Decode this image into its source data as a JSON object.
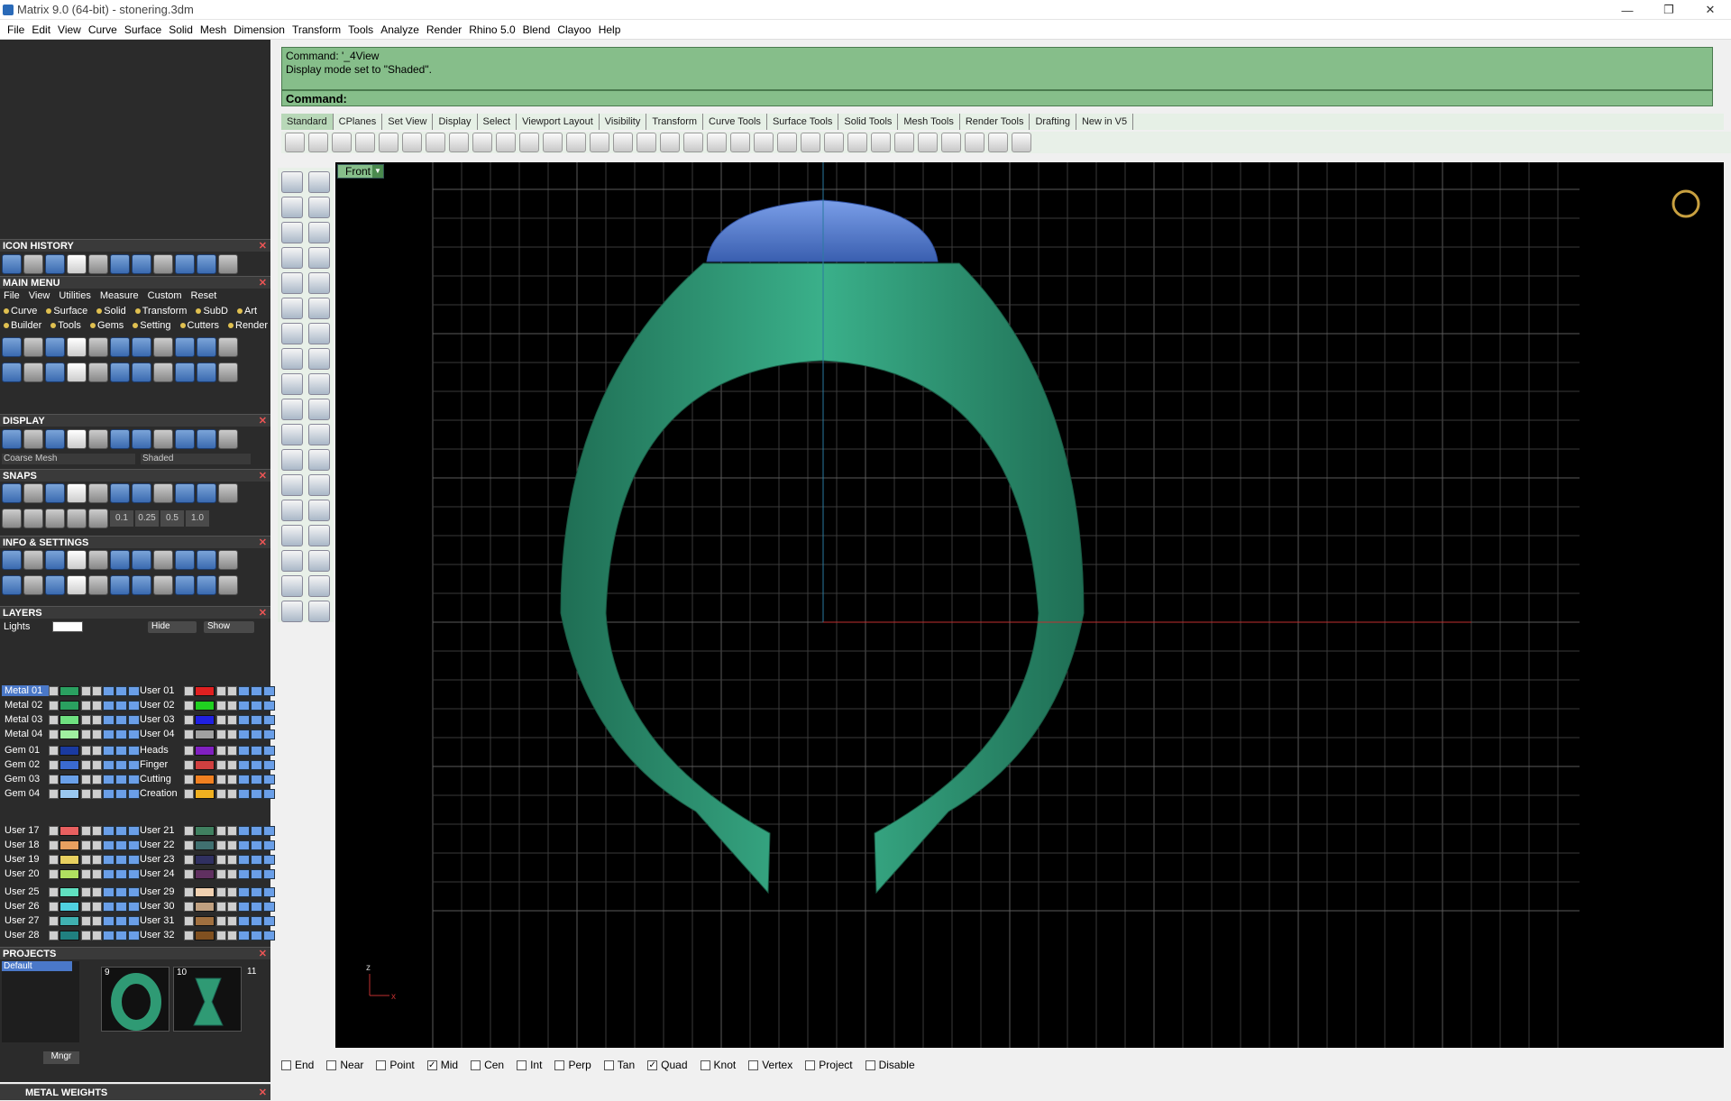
{
  "window": {
    "title": "Matrix 9.0 (64-bit) - stonering.3dm",
    "minimize": "—",
    "restore": "❐",
    "close": "✕"
  },
  "menu": [
    "File",
    "Edit",
    "View",
    "Curve",
    "Surface",
    "Solid",
    "Mesh",
    "Dimension",
    "Transform",
    "Tools",
    "Analyze",
    "Render",
    "Rhino 5.0",
    "Blend",
    "Clayoo",
    "Help"
  ],
  "command": {
    "history1": "Command: '_4View",
    "history2": "Display mode set to \"Shaded\".",
    "prompt": "Command:",
    "value": ""
  },
  "tabs": [
    "Standard",
    "CPlanes",
    "Set View",
    "Display",
    "Select",
    "Viewport Layout",
    "Visibility",
    "Transform",
    "Curve Tools",
    "Surface Tools",
    "Solid Tools",
    "Mesh Tools",
    "Render Tools",
    "Drafting",
    "New in V5"
  ],
  "viewport": {
    "name": "Front",
    "axis_z": "z",
    "axis_x": "x"
  },
  "panels": {
    "icon_history": "ICON HISTORY",
    "main_menu": "MAIN MENU",
    "main_menu_tabs": [
      "File",
      "View",
      "Utilities",
      "Measure",
      "Custom",
      "Reset"
    ],
    "main_menu_row1": [
      "Curve",
      "Surface",
      "Solid",
      "Transform",
      "SubD",
      "Art"
    ],
    "main_menu_row2": [
      "Builder",
      "Tools",
      "Gems",
      "Setting",
      "Cutters",
      "Render"
    ],
    "display": "DISPLAY",
    "display_mesh": "Coarse Mesh",
    "display_mode": "Shaded",
    "snaps": "SNAPS",
    "snap_values": [
      "0.1",
      "0.25",
      "0.5",
      "1.0"
    ],
    "info_settings": "INFO & SETTINGS",
    "layers": "LAYERS",
    "lights": "Lights",
    "hide": "Hide",
    "show": "Show",
    "projects": "PROJECTS",
    "project_default": "Default",
    "project_nums": [
      "9",
      "10",
      "11"
    ],
    "mngr": "Mngr",
    "metal_weights": "METAL WEIGHTS"
  },
  "layers_left": [
    {
      "name": "Metal 01",
      "color": "#2aa060"
    },
    {
      "name": "Metal 02",
      "color": "#2aa060"
    },
    {
      "name": "Metal 03",
      "color": "#6fe080"
    },
    {
      "name": "Metal 04",
      "color": "#a0f0a0"
    },
    {
      "name": "Gem 01",
      "color": "#1a3aa0"
    },
    {
      "name": "Gem 02",
      "color": "#3a6ad0"
    },
    {
      "name": "Gem 03",
      "color": "#6aa0e8"
    },
    {
      "name": "Gem 04",
      "color": "#9ac8f0"
    },
    {
      "name": "User 17",
      "color": "#e86060"
    },
    {
      "name": "User 18",
      "color": "#e8a060"
    },
    {
      "name": "User 19",
      "color": "#e8d060"
    },
    {
      "name": "User 20",
      "color": "#b0e060"
    },
    {
      "name": "User 25",
      "color": "#60e0c0"
    },
    {
      "name": "User 26",
      "color": "#50d0e0"
    },
    {
      "name": "User 27",
      "color": "#40b0b0"
    },
    {
      "name": "User 28",
      "color": "#208080"
    }
  ],
  "layers_right": [
    {
      "name": "User 01",
      "color": "#e02020"
    },
    {
      "name": "User 02",
      "color": "#20d020"
    },
    {
      "name": "User 03",
      "color": "#2020e0"
    },
    {
      "name": "User 04",
      "color": "#a0a0a0"
    },
    {
      "name": "Heads",
      "color": "#8020c0"
    },
    {
      "name": "Finger",
      "color": "#d04040"
    },
    {
      "name": "Cutting",
      "color": "#f08020"
    },
    {
      "name": "Creation",
      "color": "#f0b020"
    },
    {
      "name": "User 21",
      "color": "#408060"
    },
    {
      "name": "User 22",
      "color": "#407070"
    },
    {
      "name": "User 23",
      "color": "#303060"
    },
    {
      "name": "User 24",
      "color": "#603060"
    },
    {
      "name": "User 29",
      "color": "#f0d0b0"
    },
    {
      "name": "User 30",
      "color": "#c0a080"
    },
    {
      "name": "User 31",
      "color": "#a07040"
    },
    {
      "name": "User 32",
      "color": "#805020"
    }
  ],
  "osnaps": [
    {
      "label": "End",
      "checked": false
    },
    {
      "label": "Near",
      "checked": false
    },
    {
      "label": "Point",
      "checked": false
    },
    {
      "label": "Mid",
      "checked": true
    },
    {
      "label": "Cen",
      "checked": false
    },
    {
      "label": "Int",
      "checked": false
    },
    {
      "label": "Perp",
      "checked": false
    },
    {
      "label": "Tan",
      "checked": false
    },
    {
      "label": "Quad",
      "checked": true
    },
    {
      "label": "Knot",
      "checked": false
    },
    {
      "label": "Vertex",
      "checked": false
    },
    {
      "label": "Project",
      "checked": false
    },
    {
      "label": "Disable",
      "checked": false
    }
  ],
  "colors": {
    "ring": "#2f9a74",
    "gem": "#4a6fc0",
    "command_bg": "#86be8a",
    "viewport_bg": "#000000",
    "grid": "#3a3a3a",
    "x_axis": "#c03030",
    "z_axis": "#2a7aa0"
  }
}
